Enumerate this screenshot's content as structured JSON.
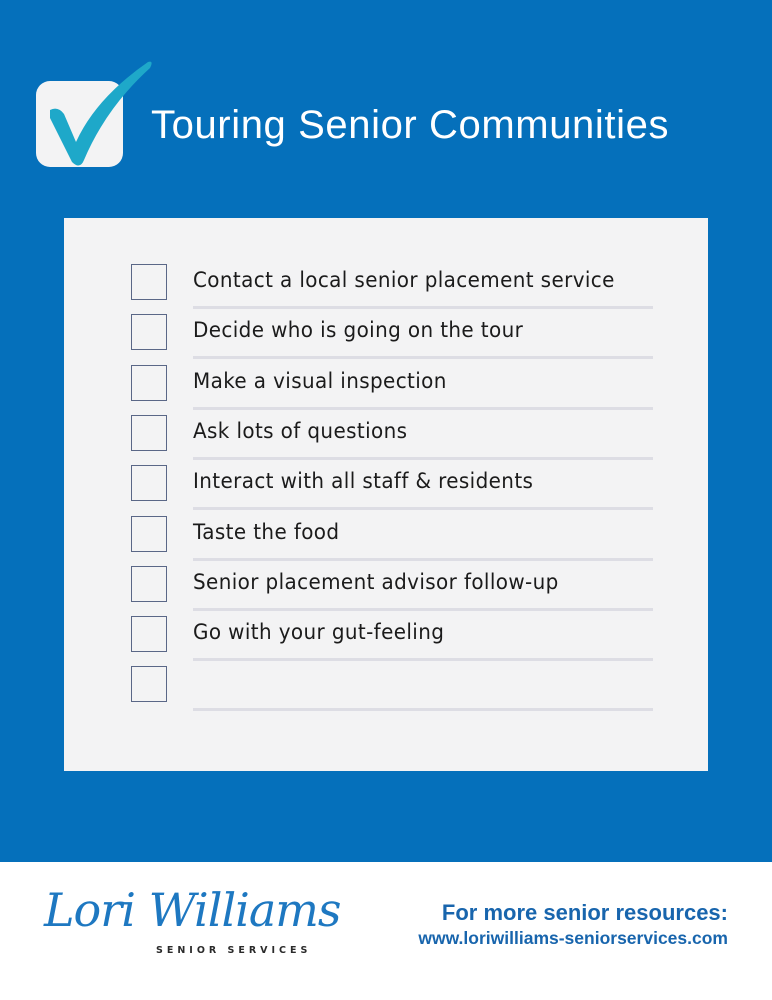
{
  "header": {
    "title": "Touring Senior Communities",
    "icon": "checkbox-checked-icon",
    "colors": {
      "background": "#0570bb",
      "check": "#1ea8c9",
      "title": "#ffffff"
    }
  },
  "checklist": {
    "items": [
      {
        "label": "Contact a local senior placement service",
        "checked": false
      },
      {
        "label": "Decide who is going on the tour",
        "checked": false
      },
      {
        "label": "Make a visual inspection",
        "checked": false
      },
      {
        "label": "Ask lots of questions",
        "checked": false
      },
      {
        "label": "Interact with all staff & residents",
        "checked": false
      },
      {
        "label": "Taste the food",
        "checked": false
      },
      {
        "label": "Senior placement advisor follow-up",
        "checked": false
      },
      {
        "label": "Go with your gut-feeling",
        "checked": false
      },
      {
        "label": "",
        "checked": false
      }
    ]
  },
  "footer": {
    "brand_name": "Lori Williams",
    "brand_subtitle": "SENIOR SERVICES",
    "cta_heading": "For more senior resources:",
    "cta_url": "www.loriwilliams-seniorservices.com",
    "colors": {
      "brand": "#1e78c1",
      "cta": "#1865ad"
    }
  }
}
